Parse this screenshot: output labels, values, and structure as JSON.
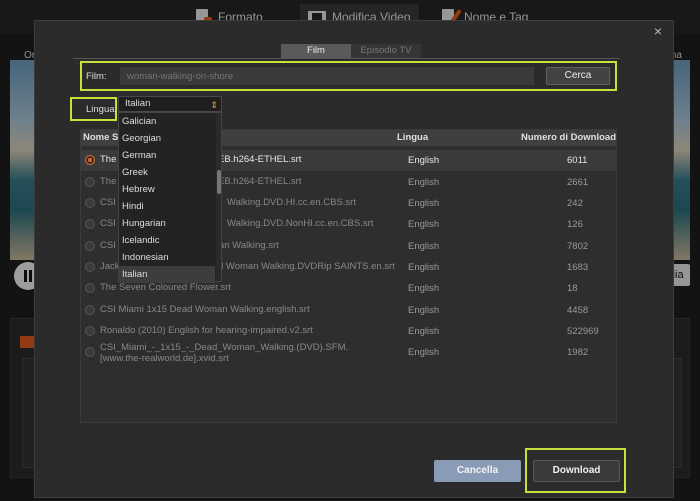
{
  "background": {
    "tabs": [
      {
        "label": "Formato",
        "icon": "format-doc-icon"
      },
      {
        "label": "Modifica Video",
        "icon": "film-edit-icon"
      },
      {
        "label": "Nome e Tag",
        "icon": "rename-tag-icon"
      }
    ],
    "video_title_left": "Or",
    "video_title_right": "ma",
    "right_button_label": "iglia"
  },
  "dialog": {
    "close_glyph": "×",
    "tabs": [
      {
        "label": "Film",
        "active": true
      },
      {
        "label": "Episodio TV",
        "active": false
      }
    ],
    "film_label": "Film:",
    "film_placeholder": "woman-walking-on-shore",
    "search_button": "Cerca",
    "language_label": "Lingua:",
    "language_selected": "Italian",
    "language_options": [
      "Galician",
      "Georgian",
      "German",
      "Greek",
      "Hebrew",
      "Hindi",
      "Hungarian",
      "Icelandic",
      "Indonesian",
      "Italian"
    ],
    "table": {
      "headers": [
        "Nome So",
        "Lingua",
        "Numero di Download"
      ],
      "rows": [
        {
          "name": "The",
          "name_tail": "EB.h264-ETHEL.srt",
          "language": "English",
          "downloads": "6011",
          "selected": true
        },
        {
          "name": "The",
          "name_tail": "EB.h264-ETHEL.srt",
          "language": "English",
          "downloads": "2661",
          "selected": false
        },
        {
          "name": "CSI M",
          "name_tail": "Walking.DVD.HI.cc.en.CBS.srt",
          "language": "English",
          "downloads": "242",
          "selected": false
        },
        {
          "name": "CSI M",
          "name_tail": "Walking.DVD.NonHI.cc.en.CBS.srt",
          "language": "English",
          "downloads": "126",
          "selected": false
        },
        {
          "name": "CSI M",
          "name_tail": "man Walking.srt",
          "language": "English",
          "downloads": "7802",
          "selected": false
        },
        {
          "name": "Jack",
          "name_tail": "d Woman Walking.DVDRip SAINTS.en.srt",
          "language": "English",
          "downloads": "1683",
          "selected": false
        },
        {
          "name": "The Seven Coloured Flower.srt",
          "name_tail": "",
          "language": "English",
          "downloads": "18",
          "selected": false
        },
        {
          "name": "CSI Miami 1x15 Dead Woman Walking.english.srt",
          "name_tail": "",
          "language": "English",
          "downloads": "4458",
          "selected": false
        },
        {
          "name": "Ronaldo (2010) English for hearing-impaired.v2.srt",
          "name_tail": "",
          "language": "English",
          "downloads": "522969",
          "selected": false
        },
        {
          "name": "CSI_Miami_-_1x15_-_Dead_Woman_Walking.(DVD).SFM.[www.the-realworld.de].xvid.srt",
          "name_tail": "",
          "language": "English",
          "downloads": "1982",
          "selected": false
        }
      ]
    },
    "cancel_button": "Cancella",
    "download_button": "Download"
  },
  "colors": {
    "highlight": "#c8e03c",
    "accent": "#e86a20",
    "cancel_button": "#8a9bb8"
  }
}
